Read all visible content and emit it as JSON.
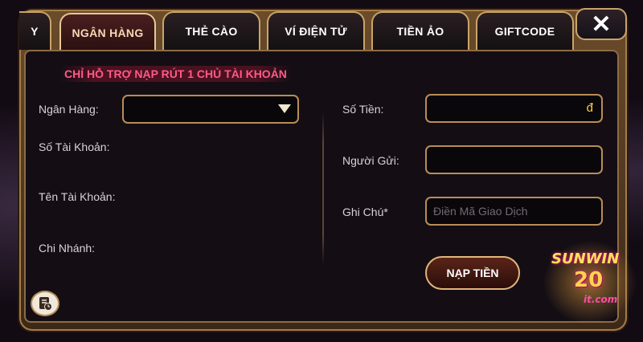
{
  "tabs": [
    {
      "label": "Y"
    },
    {
      "label": "NGÂN HÀNG"
    },
    {
      "label": "THẺ CÀO"
    },
    {
      "label": "VÍ ĐIỆN TỬ"
    },
    {
      "label": "TIỀN ẢO"
    },
    {
      "label": "GIFTCODE"
    }
  ],
  "active_tab": "NGÂN HÀNG",
  "close_symbol": "✕",
  "notice": "CHỈ HỖ TRỢ NẠP RÚT 1 CHỦ TÀI KHOẢN",
  "left_form": {
    "bank_label": "Ngân Hàng:",
    "bank_value": "",
    "account_number_label": "Số Tài Khoản:",
    "account_name_label": "Tên Tài Khoản:",
    "branch_label": "Chi Nhánh:"
  },
  "right_form": {
    "amount_label": "Số Tiền:",
    "amount_value": "",
    "currency_symbol": "đ",
    "sender_label": "Người Gửi:",
    "sender_value": "",
    "note_label": "Ghi Chú*",
    "note_placeholder": "Điền Mã Giao Dịch"
  },
  "submit_label": "NẠP TIỀN",
  "icons": {
    "history": "history-icon",
    "dropdown": "chevron-down-icon",
    "close": "close-icon"
  },
  "watermark": {
    "line1": "SUNWIN",
    "line2": "20",
    "line3": "it.com"
  },
  "colors": {
    "accent_gold": "#c9a46a",
    "notice_pink": "#ff5a8a",
    "currency_yellow": "#f5d24d"
  }
}
